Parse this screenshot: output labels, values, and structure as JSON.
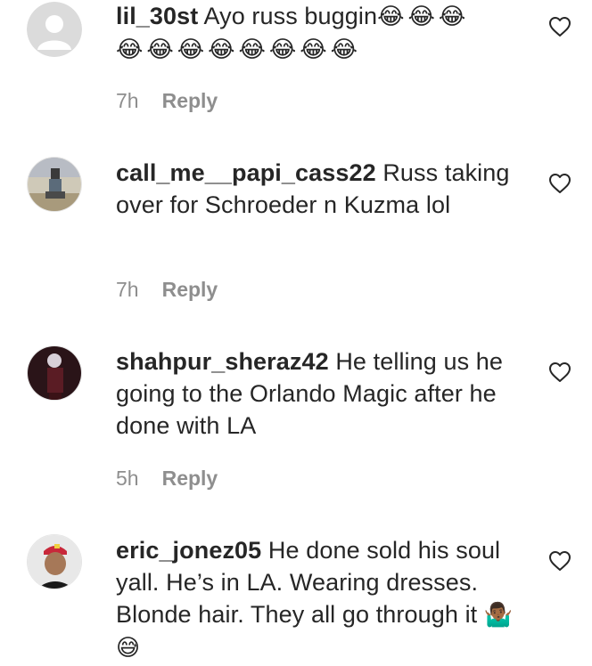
{
  "comments": [
    {
      "username": "lil_30st",
      "text": " Ayo russ buggin",
      "emoji_line1": "😂😂😂",
      "emoji_line2": "😂😂😂😂😂😂😂😂",
      "time": "7h",
      "reply": "Reply"
    },
    {
      "username": "call_me__papi_cass22",
      "text": " Russ taking over for Schroeder n Kuzma lol",
      "time": "7h",
      "reply": "Reply"
    },
    {
      "username": "shahpur_sheraz42",
      "text": " He telling us he going to the Orlando Magic after he done with LA",
      "time": "5h",
      "reply": "Reply"
    },
    {
      "username": "eric_jonez05",
      "text": " He done sold his soul yall. He’s in LA. Wearing dresses. Blonde hair. They all go through it ",
      "emoji_tail": "🤷🏾‍♂️ 😅"
    }
  ],
  "icons": {
    "like": "heart-outline-icon",
    "avatar_default": "default-user-icon"
  },
  "colors": {
    "text": "#262626",
    "secondary": "#8e8e8e",
    "avatar_default_bg": "#dbdbdb"
  }
}
